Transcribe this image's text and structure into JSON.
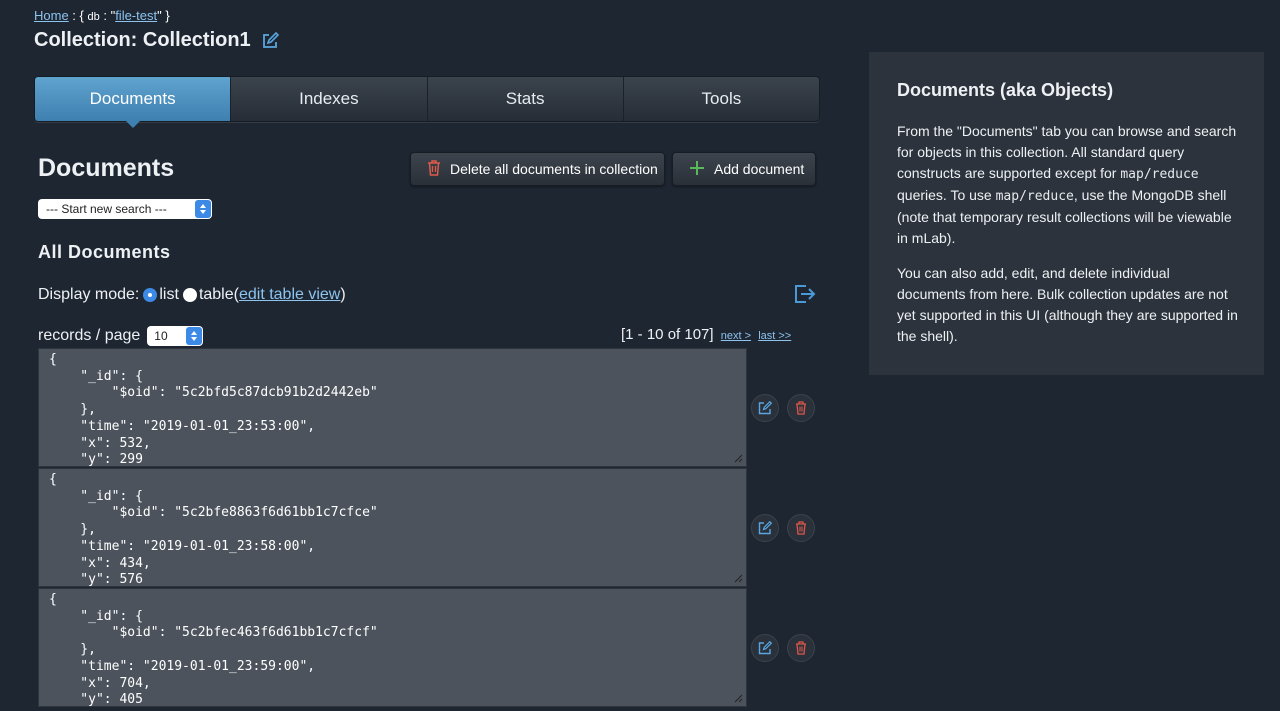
{
  "breadcrumb": {
    "home": "Home",
    "sep1": " : { ",
    "db_key": "db",
    "sep2": " : \"",
    "db_name": "file-test",
    "sep3": "\" }"
  },
  "header": {
    "title": "Collection: Collection1"
  },
  "tabs": [
    {
      "label": "Documents",
      "active": true
    },
    {
      "label": "Indexes",
      "active": false
    },
    {
      "label": "Stats",
      "active": false
    },
    {
      "label": "Tools",
      "active": false
    }
  ],
  "documents_section": {
    "heading": "Documents",
    "delete_all_label": "Delete all documents in collection",
    "add_document_label": "Add document",
    "search_select_value": "--- Start new search ---",
    "all_documents_heading": "All Documents",
    "display_mode_label": "Display mode:",
    "list_label": "list",
    "table_label": "table",
    "open_paren": " (",
    "edit_table_view": "edit table view",
    "close_paren": ")",
    "records_per_page_label": "records / page",
    "records_per_page_value": "10",
    "pager_range": "[1 - 10 of 107]",
    "next_label": "next >",
    "last_label": "last >>"
  },
  "docs": [
    {
      "text": "{\n    \"_id\": {\n        \"$oid\": \"5c2bfd5c87dcb91b2d2442eb\"\n    },\n    \"time\": \"2019-01-01_23:53:00\",\n    \"x\": 532,\n    \"y\": 299\n}"
    },
    {
      "text": "{\n    \"_id\": {\n        \"$oid\": \"5c2bfe8863f6d61bb1c7cfce\"\n    },\n    \"time\": \"2019-01-01_23:58:00\",\n    \"x\": 434,\n    \"y\": 576\n}"
    },
    {
      "text": "{\n    \"_id\": {\n        \"$oid\": \"5c2bfec463f6d61bb1c7cfcf\"\n    },\n    \"time\": \"2019-01-01_23:59:00\",\n    \"x\": 704,\n    \"y\": 405\n}"
    }
  ],
  "info_panel": {
    "title": "Documents (aka Objects)",
    "p1_a": "From the \"Documents\" tab you can browse and search for objects in this collection. All standard query constructs are supported except for ",
    "p1_code1": "map/reduce",
    "p1_b": " queries. To use ",
    "p1_code2": "map/reduce",
    "p1_c": ", use the MongoDB shell (note that temporary result collections will be viewable in mLab).",
    "p2": "You can also add, edit, and delete individual documents from here. Bulk collection updates are not yet supported in this UI (although they are supported in the shell)."
  },
  "icons": {
    "edit_title": "pencil-square-icon",
    "delete_all": "trash-icon",
    "add_document": "plus-icon",
    "export": "export-icon",
    "edit_doc": "pencil-square-icon",
    "delete_doc": "trash-icon"
  },
  "colors": {
    "background": "#1e2632",
    "active_tab": "#4a90c4",
    "link": "#8cc3ef",
    "delete_red": "#e05a4a",
    "add_green": "#5cb85c",
    "panel": "#2c333c",
    "doc_bg": "#4c535c"
  }
}
